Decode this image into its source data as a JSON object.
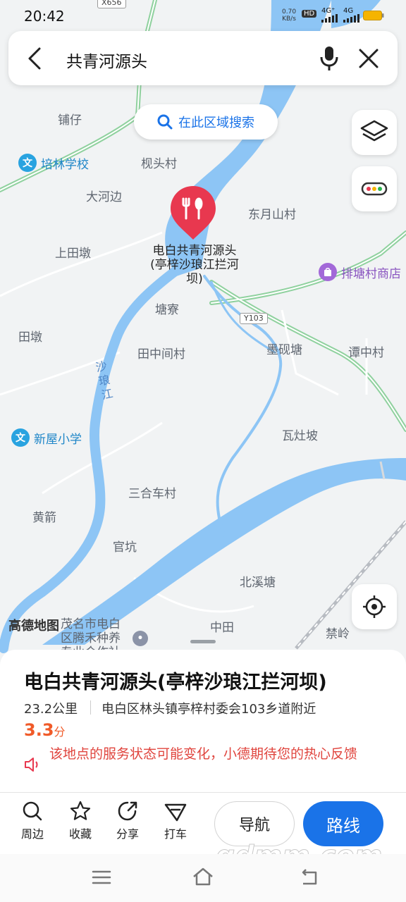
{
  "status_bar": {
    "time": "20:42",
    "net_speed": "0.70",
    "net_unit": "KB/s",
    "hd_label": "HD",
    "sim1_label": "4G⁺",
    "sim2_label": "4G"
  },
  "search": {
    "query": "共青河源头",
    "icons": [
      "back-arrow-icon",
      "microphone-icon",
      "close-icon"
    ]
  },
  "map": {
    "area_search_label": "在此区域搜索",
    "road_tags": [
      "X656",
      "Y103"
    ],
    "place_labels": [
      "铺仔",
      "枧头村",
      "大河边",
      "东月山村",
      "上田墩",
      "塘寮",
      "田中间村",
      "墨砚塘",
      "谭中村",
      "田墩",
      "瓦灶坡",
      "三合车村",
      "黄箭",
      "官坑",
      "北溪塘",
      "中田",
      "禁岭"
    ],
    "river_label": "沙琅江",
    "pois": {
      "school1": "培林学校",
      "school2": "新屋小学",
      "shop": "排塘村商店",
      "org": "茂名市电白区腾禾种养专业合作社"
    },
    "selected_marker_label": "电白共青河源头(亭梓沙琅江拦河坝)",
    "map_logo": "高德地图",
    "colors": {
      "water": "#8dc5f5",
      "background": "#f1f3f4",
      "marker": "#e8384f",
      "road_green": "#8fd19e"
    }
  },
  "place_card": {
    "title": "电白共青河源头(亭梓沙琅江拦河坝)",
    "distance": "23.2公里",
    "address": "电白区林头镇亭梓村委会103乡道附近",
    "rating_value": "3.3",
    "rating_unit": "分",
    "notice": "该地点的服务状态可能变化，小德期待您的热心反馈"
  },
  "actions": [
    {
      "label": "周边",
      "icon": "search-icon"
    },
    {
      "label": "收藏",
      "icon": "star-icon"
    },
    {
      "label": "分享",
      "icon": "share-icon"
    },
    {
      "label": "打车",
      "icon": "taxi-icon"
    }
  ],
  "buttons": {
    "navigate": "导航",
    "route": "路线"
  },
  "watermark": "gdmm.com",
  "nav_bar": {
    "icons": [
      "menu-icon",
      "home-icon",
      "back-icon"
    ]
  }
}
